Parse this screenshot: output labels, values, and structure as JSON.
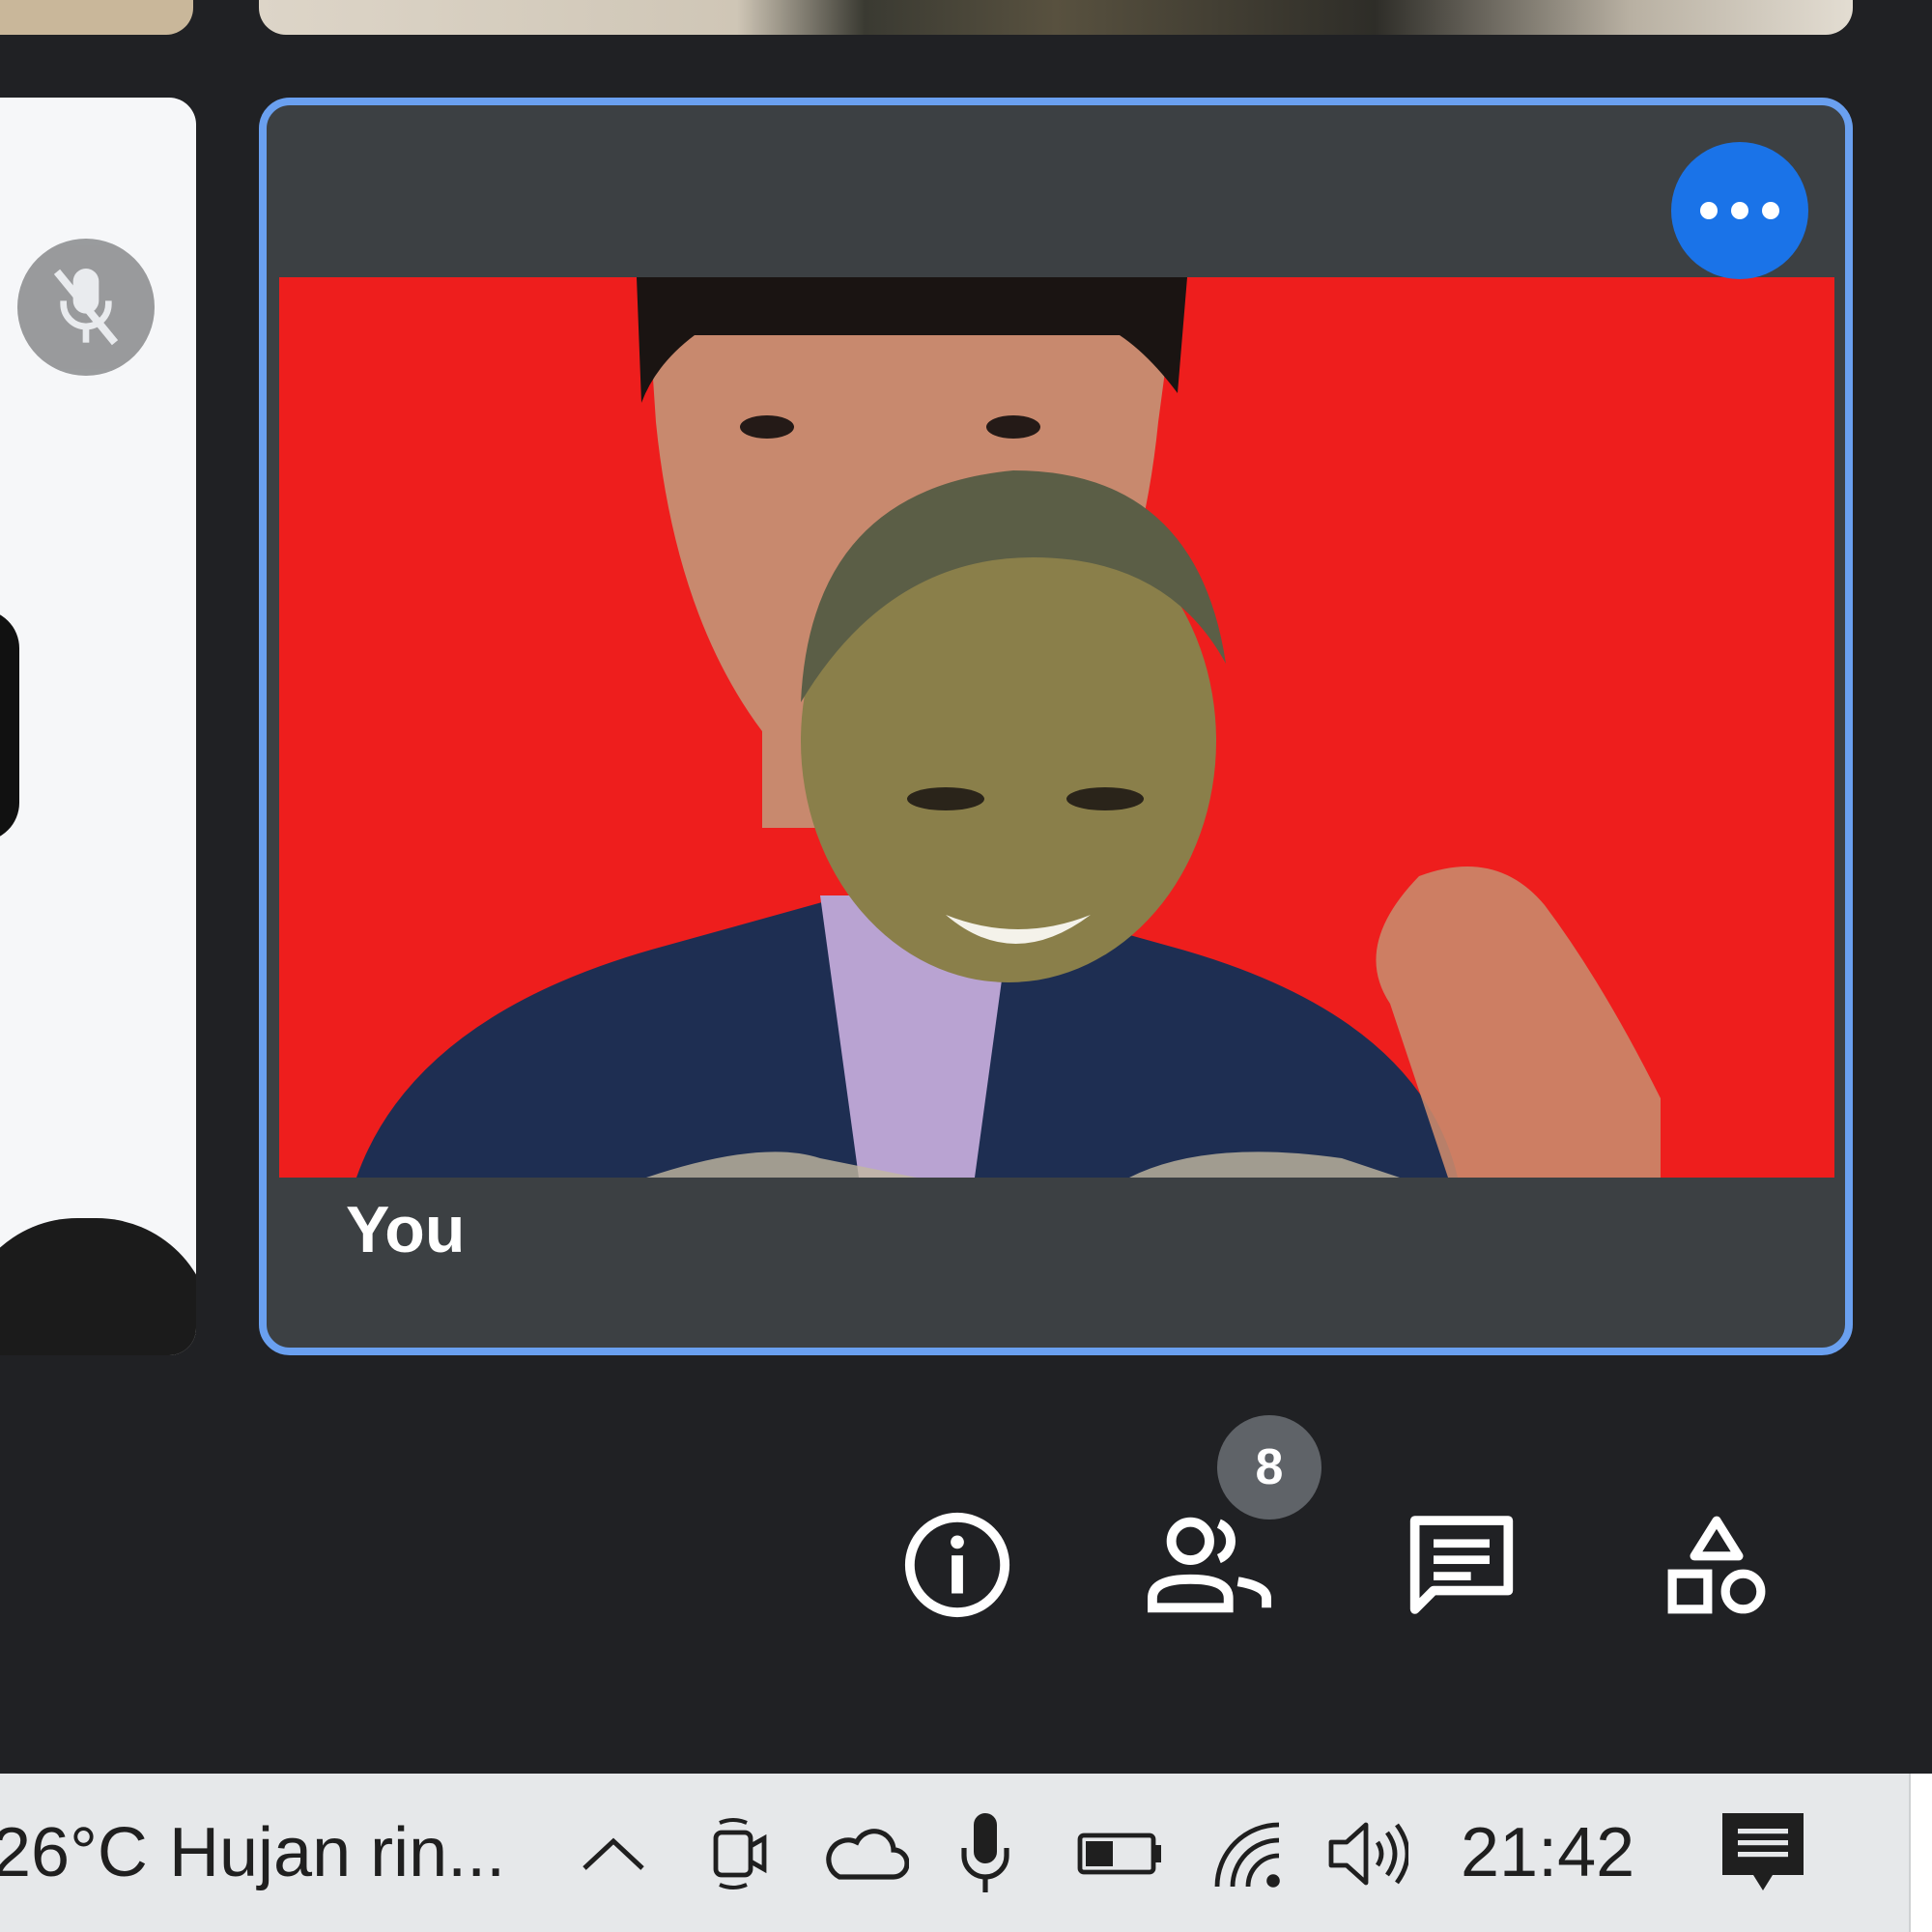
{
  "participants": {
    "self_label": "You",
    "count": "8"
  },
  "toolbar": {
    "info_icon": "info-icon",
    "people_icon": "people-icon",
    "chat_icon": "chat-icon",
    "activities_icon": "activities-icon"
  },
  "taskbar": {
    "temperature": "26°C",
    "weather": "Hujan rin...",
    "time": "21:42"
  },
  "colors": {
    "background": "#202124",
    "tile": "#3c4043",
    "active_border": "#6aa0f0",
    "accent": "#1a73e8",
    "video_background": "#ee1e1d",
    "taskbar": "#e6e8ea"
  }
}
